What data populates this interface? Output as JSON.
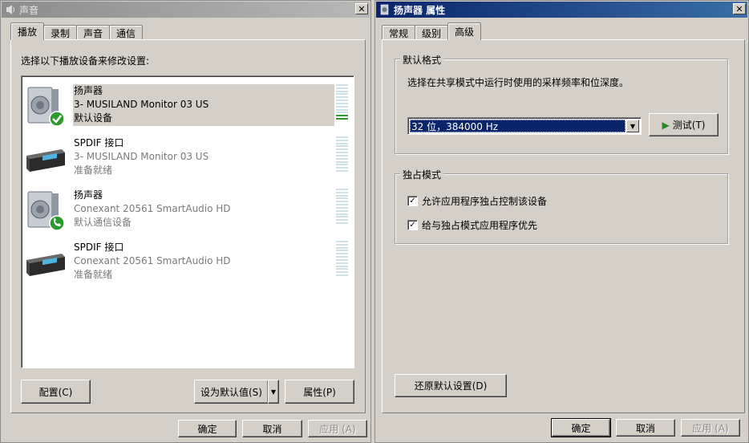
{
  "left_window": {
    "title": "声音",
    "tabs": [
      "播放",
      "录制",
      "声音",
      "通信"
    ],
    "instruction": "选择以下播放设备来修改设置:",
    "devices": [
      {
        "name": "扬声器",
        "line1": "3- MUSILAND Monitor 03 US",
        "line2": "默认设备",
        "icon": "speaker-icon",
        "badge": "default-check-icon",
        "selected": true,
        "level": 0.2
      },
      {
        "name": "SPDIF 接口",
        "line1": "3- MUSILAND Monitor 03 US",
        "line2": "准备就绪",
        "icon": "spdif-receiver-icon",
        "badge": "",
        "selected": false,
        "level": 0
      },
      {
        "name": "扬声器",
        "line1": "Conexant 20561 SmartAudio HD",
        "line2": "默认通信设备",
        "icon": "speaker-icon",
        "badge": "phone-icon",
        "selected": false,
        "level": 0
      },
      {
        "name": "SPDIF 接口",
        "line1": "Conexant 20561 SmartAudio HD",
        "line2": "准备就绪",
        "icon": "spdif-receiver-icon",
        "badge": "",
        "selected": false,
        "level": 0
      }
    ],
    "buttons": {
      "configure": "配置(C)",
      "set_default": "设为默认值(S)",
      "properties": "属性(P)"
    },
    "dialog": {
      "ok": "确定",
      "cancel": "取消",
      "apply": "应用 (A)"
    }
  },
  "right_window": {
    "title": "扬声器 属性",
    "tabs": [
      "常规",
      "级别",
      "高级"
    ],
    "active_tab": "高级",
    "default_format": {
      "label": "默认格式",
      "description": "选择在共享模式中运行时使用的采样频率和位深度。",
      "selected_value": "32 位，384000 Hz",
      "test_button": "测试(T)"
    },
    "exclusive_mode": {
      "label": "独占模式",
      "options": [
        {
          "label": "允许应用程序独占控制该设备",
          "checked": true
        },
        {
          "label": "给与独占模式应用程序优先",
          "checked": true
        }
      ]
    },
    "restore_button": "还原默认设置(D)",
    "dialog": {
      "ok": "确定",
      "cancel": "取消",
      "apply": "应用 (A)"
    }
  },
  "colors": {
    "accent": "#0a246a",
    "meter_on": "#2a9a2a",
    "meter_off": "#cfe0e6"
  }
}
